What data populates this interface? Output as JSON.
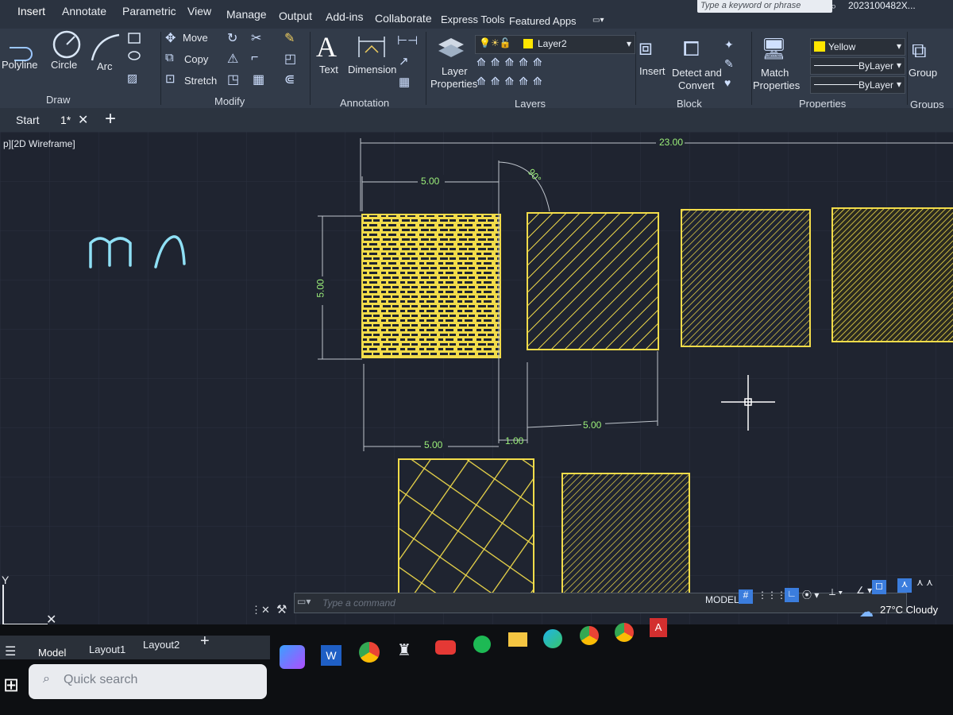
{
  "ribbon_tabs": [
    "Insert",
    "Annotate",
    "Parametric",
    "View",
    "Manage",
    "Output",
    "Add-ins",
    "Collaborate",
    "Express Tools",
    "Featured Apps"
  ],
  "search_placeholder": "Type a keyword or phrase",
  "user": "2023100482X...",
  "draw": {
    "label": "Draw",
    "polyline": "Polyline",
    "circle": "Circle",
    "arc": "Arc"
  },
  "modify": {
    "label": "Modify",
    "move": "Move",
    "copy": "Copy",
    "stretch": "Stretch"
  },
  "annotation": {
    "label": "Annotation",
    "text": "Text",
    "dimension": "Dimension"
  },
  "layers": {
    "label": "Layers",
    "properties_line1": "Layer",
    "properties_line2": "Properties",
    "current": "Layer2"
  },
  "block": {
    "label": "Block",
    "insert": "Insert",
    "detect_line1": "Detect and",
    "detect_line2": "Convert"
  },
  "properties": {
    "label": "Properties",
    "match_line1": "Match",
    "match_line2": "Properties",
    "color": "Yellow",
    "color_hex": "#ffe600",
    "linetype": "ByLayer",
    "lineweight": "ByLayer"
  },
  "groups": {
    "label": "Groups",
    "group": "Group"
  },
  "doc_tabs": {
    "start": "Start",
    "file": "1*"
  },
  "viewport_label": "p][2D Wireframe]",
  "dims": {
    "overall": "23.00",
    "top": "5.00",
    "angle": "90°",
    "left": "5.00",
    "bottom": "5.00",
    "gap": "1.00",
    "right": "5.00"
  },
  "command_placeholder": "Type a command",
  "status": {
    "model": "MODEL"
  },
  "layout_tabs": [
    "Model",
    "Layout1",
    "Layout2"
  ],
  "taskbar": {
    "search_placeholder": "Quick search"
  },
  "weather": "27°C  Cloudy",
  "colors": {
    "hatch": "#f2dc4a",
    "dim": "#bfc5cc",
    "dim_text": "#9cf07a",
    "canvas": "#1f2430",
    "ribbon": "#323b49"
  }
}
